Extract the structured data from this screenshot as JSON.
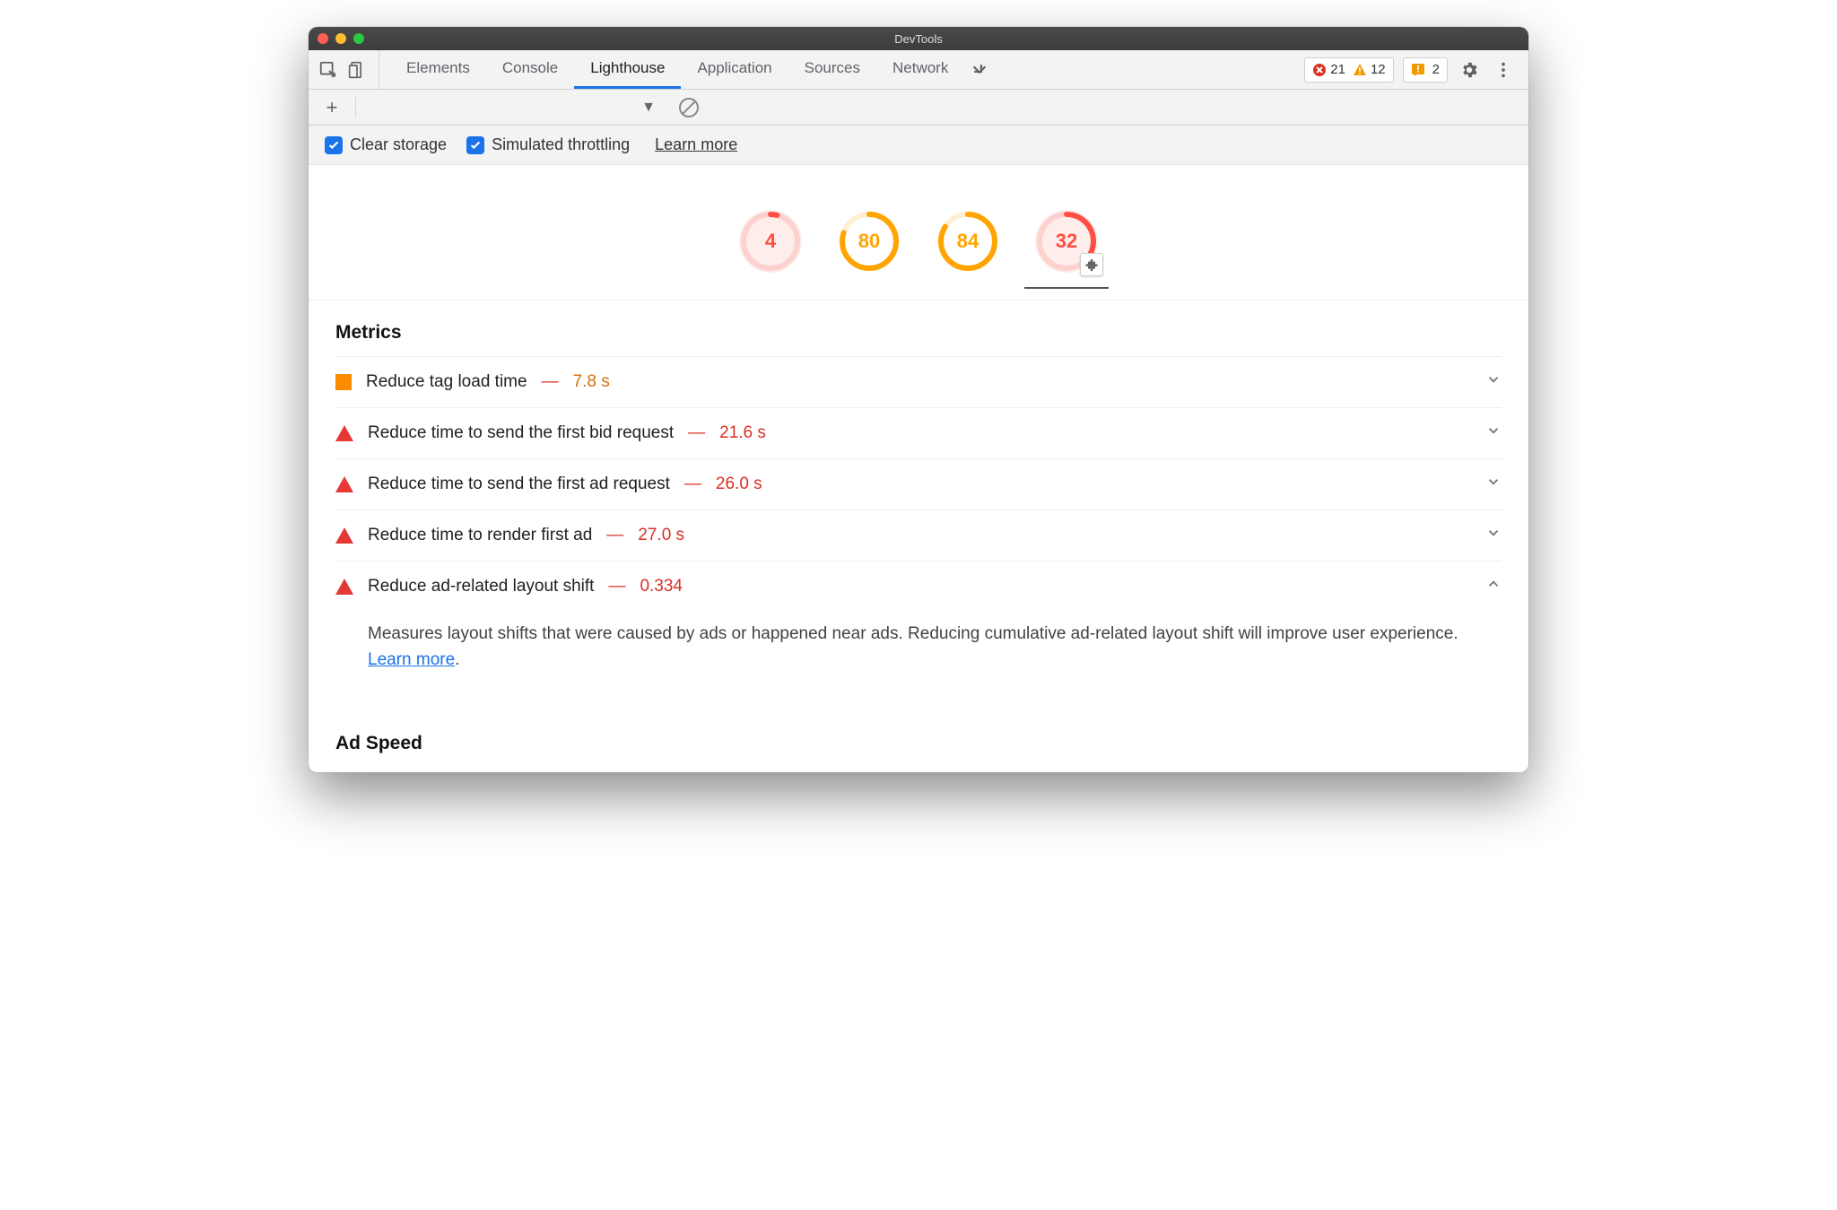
{
  "window": {
    "title": "DevTools"
  },
  "tabs": {
    "items": [
      "Elements",
      "Console",
      "Lighthouse",
      "Application",
      "Sources",
      "Network"
    ],
    "active_index": 2
  },
  "counters": {
    "errors": "21",
    "warnings": "12",
    "issues": "2"
  },
  "options": {
    "clear_storage": "Clear storage",
    "simulated_throttling": "Simulated throttling",
    "learn_more": "Learn more"
  },
  "gauges": [
    {
      "value": 4,
      "color": "#ff4e42",
      "bg": "#fdeeec",
      "ring": true
    },
    {
      "value": 80,
      "color": "#ffa400",
      "bg": "#ffffff",
      "ring": true
    },
    {
      "value": 84,
      "color": "#ffa400",
      "bg": "#ffffff",
      "ring": true
    },
    {
      "value": 32,
      "color": "#ff4e42",
      "bg": "#fdeeec",
      "ring": true,
      "plugin": true,
      "active": true
    }
  ],
  "sections": {
    "metrics_title": "Metrics",
    "ad_speed_title": "Ad Speed"
  },
  "metrics": [
    {
      "marker": "square",
      "name": "Reduce tag load time",
      "value": "7.8 s",
      "severity": "orange",
      "expanded": false
    },
    {
      "marker": "triangle",
      "name": "Reduce time to send the first bid request",
      "value": "21.6 s",
      "severity": "red",
      "expanded": false
    },
    {
      "marker": "triangle",
      "name": "Reduce time to send the first ad request",
      "value": "26.0 s",
      "severity": "red",
      "expanded": false
    },
    {
      "marker": "triangle",
      "name": "Reduce time to render first ad",
      "value": "27.0 s",
      "severity": "red",
      "expanded": false
    },
    {
      "marker": "triangle",
      "name": "Reduce ad-related layout shift",
      "value": "0.334",
      "severity": "red",
      "expanded": true,
      "description": "Measures layout shifts that were caused by ads or happened near ads. Reducing cumulative ad-related layout shift will improve user experience. ",
      "link_text": "Learn more"
    }
  ]
}
